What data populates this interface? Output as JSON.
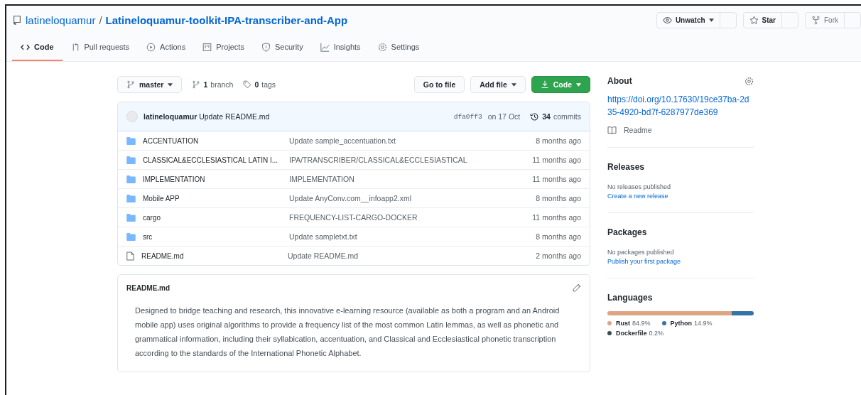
{
  "repo": {
    "owner": "latineloquamur",
    "separator": "/",
    "name": "Latineloquamur-toolkit-IPA-transcriber-and-App"
  },
  "actions": [
    {
      "label": "Unwatch",
      "kind": "watch"
    },
    {
      "label": "Star",
      "kind": "star"
    },
    {
      "label": "Fork",
      "kind": "fork"
    }
  ],
  "tabs": [
    {
      "label": "Code",
      "kind": "code",
      "selected": true
    },
    {
      "label": "Pull requests",
      "kind": "pr",
      "selected": false
    },
    {
      "label": "Actions",
      "kind": "actions",
      "selected": false
    },
    {
      "label": "Projects",
      "kind": "projects",
      "selected": false
    },
    {
      "label": "Security",
      "kind": "security",
      "selected": false
    },
    {
      "label": "Insights",
      "kind": "insights",
      "selected": false
    },
    {
      "label": "Settings",
      "kind": "settings",
      "selected": false
    }
  ],
  "toolbar": {
    "branch": "master",
    "branches_count": "1",
    "branches_label": "branch",
    "tags_count": "0",
    "tags_label": "tags",
    "go_to_file": "Go to file",
    "add_file": "Add file",
    "code": "Code"
  },
  "commit": {
    "author": "latineloquamur",
    "message": "Update README.md",
    "sha": "dfa0ff3",
    "date": "on 17 Oct",
    "count": "34",
    "count_label": "commits"
  },
  "files": [
    {
      "kind": "folder",
      "name": "ACCENTUATION",
      "message": "Update sample_accentuation.txt",
      "age": "8 months ago"
    },
    {
      "kind": "folder",
      "name": "CLASSICAL&ECCLESIASTICAL LATIN I...",
      "message": "IPA/TRANSCRIBER/CLASSICAL&ECCLESIASTICAL",
      "age": "11 months ago"
    },
    {
      "kind": "folder",
      "name": "IMPLEMENTATION",
      "message": "IMPLEMENTATION",
      "age": "11 months ago"
    },
    {
      "kind": "folder",
      "name": "Mobile APP",
      "message": "Update AnyConv.com__infoapp2.xml",
      "age": "8 months ago"
    },
    {
      "kind": "folder",
      "name": "cargo",
      "message": "FREQUENCY-LIST-CARGO-DOCKER",
      "age": "11 months ago"
    },
    {
      "kind": "folder",
      "name": "src",
      "message": "Update sampletxt.txt",
      "age": "8 months ago"
    },
    {
      "kind": "file",
      "name": "README.md",
      "message": "Update README.md",
      "age": "2 months ago"
    }
  ],
  "readme": {
    "title": "README.md",
    "text": "Designed to bridge teaching and research, this innovative e-learning resource (available as both a program and an Android mobile app) uses original algorithms to provide a frequency list of the most common Latin lemmas, as well as phonetic and grammatical information, including their syllabication, accentuation, and Classical and Ecclesiastical phonetic transcription according to the standards of the International Phonetic Alphabet."
  },
  "about": {
    "title": "About",
    "link": "https://doi.org/10.17630/19ce37ba-2d35-4920-bd7f-6287977de369",
    "readme": "Readme"
  },
  "releases": {
    "title": "Releases",
    "note": "No releases published",
    "link": "Create a new release"
  },
  "packages": {
    "title": "Packages",
    "note": "No packages published",
    "link": "Publish your first package"
  },
  "languages": {
    "title": "Languages",
    "items": [
      {
        "name": "Rust",
        "percent": "84.9%",
        "color": "#dea584"
      },
      {
        "name": "Python",
        "percent": "14.9%",
        "color": "#3572a5"
      },
      {
        "name": "Dockerfile",
        "percent": "0.2%",
        "color": "#384d54"
      }
    ]
  }
}
